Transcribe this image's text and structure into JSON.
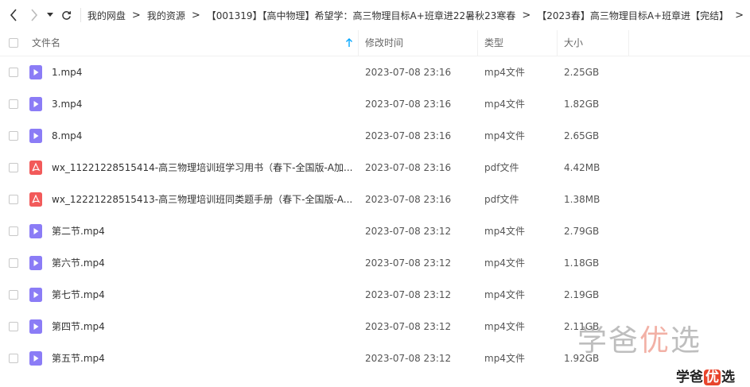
{
  "breadcrumb": [
    "我的网盘",
    "我的资源",
    "【001319】【高中物理】希望学：高三物理目标A+班章进22暑秋23寒春",
    "【2023春】高三物理目标A+班章进【完结】"
  ],
  "breadcrumb_sep": ">",
  "columns": {
    "name": "文件名",
    "modified": "修改时间",
    "type": "类型",
    "size": "大小"
  },
  "files": [
    {
      "name": "1.mp4",
      "modified": "2023-07-08 23:16",
      "type": "mp4文件",
      "size": "2.25GB",
      "icon": "video-file-icon"
    },
    {
      "name": "3.mp4",
      "modified": "2023-07-08 23:16",
      "type": "mp4文件",
      "size": "1.82GB",
      "icon": "video-file-icon"
    },
    {
      "name": "8.mp4",
      "modified": "2023-07-08 23:16",
      "type": "mp4文件",
      "size": "2.65GB",
      "icon": "video-file-icon"
    },
    {
      "name": "wx_11221228515414-高三物理培训班学习用书（春下-全国版-A加...",
      "modified": "2023-07-08 23:16",
      "type": "pdf文件",
      "size": "4.42MB",
      "icon": "pdf-file-icon"
    },
    {
      "name": "wx_12221228515413-高三物理培训班同类题手册（春下-全国版-A...",
      "modified": "2023-07-08 23:16",
      "type": "pdf文件",
      "size": "1.38MB",
      "icon": "pdf-file-icon"
    },
    {
      "name": "第二节.mp4",
      "modified": "2023-07-08 23:12",
      "type": "mp4文件",
      "size": "2.79GB",
      "icon": "video-file-icon"
    },
    {
      "name": "第六节.mp4",
      "modified": "2023-07-08 23:12",
      "type": "mp4文件",
      "size": "1.18GB",
      "icon": "video-file-icon"
    },
    {
      "name": "第七节.mp4",
      "modified": "2023-07-08 23:12",
      "type": "mp4文件",
      "size": "2.19GB",
      "icon": "video-file-icon"
    },
    {
      "name": "第四节.mp4",
      "modified": "2023-07-08 23:12",
      "type": "mp4文件",
      "size": "2.11GB",
      "icon": "video-file-icon"
    },
    {
      "name": "第五节.mp4",
      "modified": "2023-07-08 23:12",
      "type": "mp4文件",
      "size": "1.92GB",
      "icon": "video-file-icon"
    }
  ],
  "watermark": {
    "big_part1": "学爸",
    "big_part2": "优",
    "big_part3": "选",
    "small_part1": "学爸",
    "small_part2": "优",
    "small_part3": "选"
  },
  "colors": {
    "video_icon": "#8b7cf6",
    "pdf_icon": "#f25a5a",
    "sort_arrow": "#06a7ff"
  }
}
